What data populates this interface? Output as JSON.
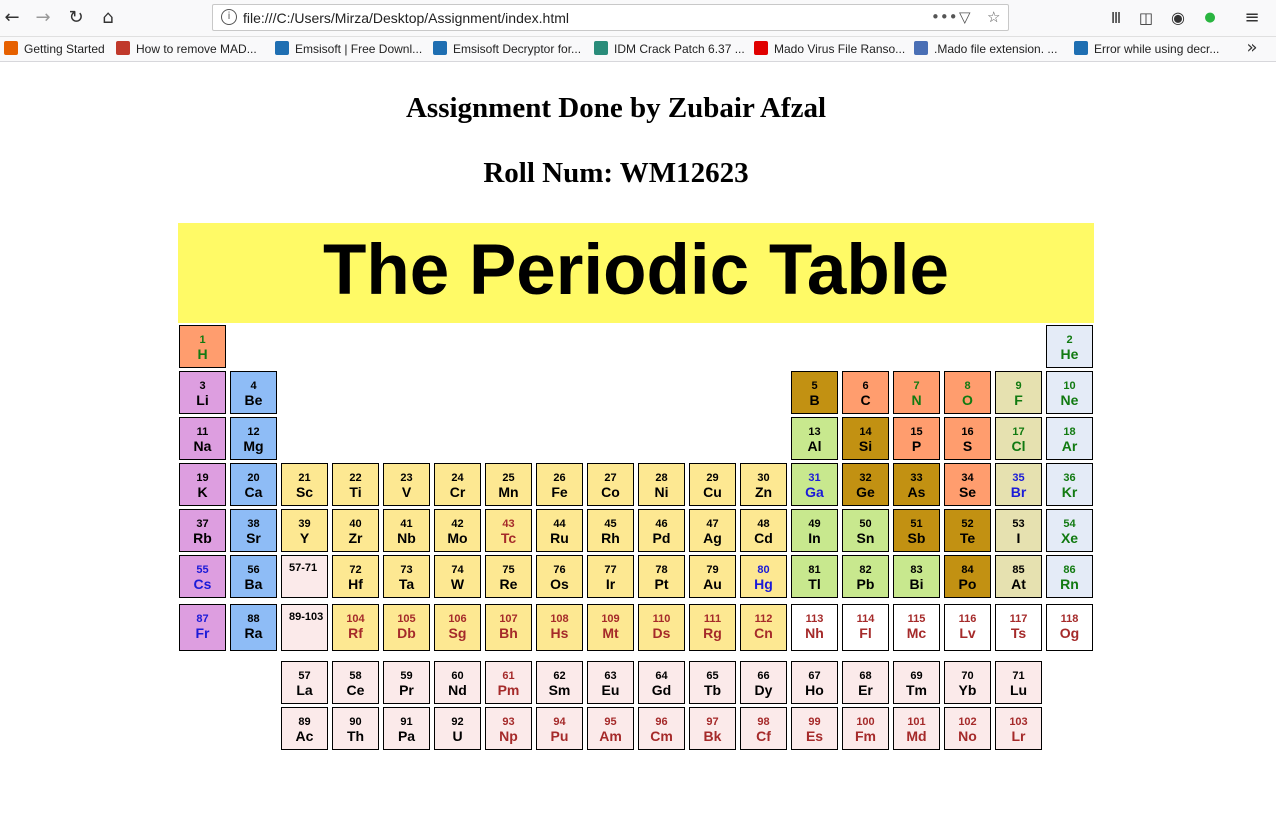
{
  "browser": {
    "url": "file:///C:/Users/Mirza/Desktop/Assignment/index.html",
    "bookmarks": [
      {
        "label": "Getting Started",
        "color": "#e66000"
      },
      {
        "label": "How to remove MAD...",
        "color": "#c0392b"
      },
      {
        "label": "Emsisoft | Free Downl...",
        "color": "#1f6fb2"
      },
      {
        "label": "Emsisoft Decryptor for...",
        "color": "#1f6fb2"
      },
      {
        "label": "IDM Crack Patch 6.37 ...",
        "color": "#2a8c7a"
      },
      {
        "label": "Mado Virus File Ranso...",
        "color": "#e00000"
      },
      {
        "label": ".Mado file extension. ...",
        "color": "#4a6fb5"
      },
      {
        "label": "Error while using decr...",
        "color": "#1f6fb2"
      }
    ],
    "icons": [
      "back-icon",
      "forward-icon",
      "reload-icon",
      "home-icon",
      "info-icon",
      "page-actions-icon",
      "pocket-icon",
      "bookmark-star-icon",
      "library-icon",
      "sidebar-icon",
      "account-icon",
      "whatsapp-icon",
      "menu-icon",
      "overflow-chevron-icon"
    ]
  },
  "page": {
    "heading": "Assignment Done by Zubair Afzal",
    "roll": "Roll Num: WM12623",
    "banner": "The Periodic Table"
  },
  "colors": {
    "banner": "#fffa66",
    "alkali": "#dd9ee0",
    "alkaline": "#8ebcf6",
    "transition": "#fde892",
    "post_transition": "#c8e88e",
    "metalloid": "#c29112",
    "nonmetal": "#ff9d6e",
    "halogen": "#e6e1b0",
    "noble": "#e4ebf7",
    "lanthanide_actinide": "#fbeaea",
    "unknown": "#ffffff",
    "gas_text": "#117a11",
    "liquid_text": "#1b1bd8",
    "synthetic_text": "#a52a2a"
  },
  "elements": [
    {
      "n": "1",
      "s": "H",
      "c": "nonmetal",
      "t": "gas"
    },
    {
      "n": "2",
      "s": "He",
      "c": "noble",
      "t": "gas"
    },
    {
      "n": "3",
      "s": "Li",
      "c": "alkali",
      "t": "solid"
    },
    {
      "n": "4",
      "s": "Be",
      "c": "alkaline",
      "t": "solid"
    },
    {
      "n": "5",
      "s": "B",
      "c": "metalloid",
      "t": "solid"
    },
    {
      "n": "6",
      "s": "C",
      "c": "nonmetal",
      "t": "solid"
    },
    {
      "n": "7",
      "s": "N",
      "c": "nonmetal",
      "t": "gas"
    },
    {
      "n": "8",
      "s": "O",
      "c": "nonmetal",
      "t": "gas"
    },
    {
      "n": "9",
      "s": "F",
      "c": "halogen",
      "t": "gas"
    },
    {
      "n": "10",
      "s": "Ne",
      "c": "noble",
      "t": "gas"
    },
    {
      "n": "11",
      "s": "Na",
      "c": "alkali",
      "t": "solid"
    },
    {
      "n": "12",
      "s": "Mg",
      "c": "alkaline",
      "t": "solid"
    },
    {
      "n": "13",
      "s": "Al",
      "c": "post",
      "t": "solid"
    },
    {
      "n": "14",
      "s": "Si",
      "c": "metalloid",
      "t": "solid"
    },
    {
      "n": "15",
      "s": "P",
      "c": "nonmetal",
      "t": "solid"
    },
    {
      "n": "16",
      "s": "S",
      "c": "nonmetal",
      "t": "solid"
    },
    {
      "n": "17",
      "s": "Cl",
      "c": "halogen",
      "t": "gas"
    },
    {
      "n": "18",
      "s": "Ar",
      "c": "noble",
      "t": "gas"
    },
    {
      "n": "19",
      "s": "K",
      "c": "alkali",
      "t": "solid"
    },
    {
      "n": "20",
      "s": "Ca",
      "c": "alkaline",
      "t": "solid"
    },
    {
      "n": "21",
      "s": "Sc",
      "c": "trans",
      "t": "solid"
    },
    {
      "n": "22",
      "s": "Ti",
      "c": "trans",
      "t": "solid"
    },
    {
      "n": "23",
      "s": "V",
      "c": "trans",
      "t": "solid"
    },
    {
      "n": "24",
      "s": "Cr",
      "c": "trans",
      "t": "solid"
    },
    {
      "n": "25",
      "s": "Mn",
      "c": "trans",
      "t": "solid"
    },
    {
      "n": "26",
      "s": "Fe",
      "c": "trans",
      "t": "solid"
    },
    {
      "n": "27",
      "s": "Co",
      "c": "trans",
      "t": "solid"
    },
    {
      "n": "28",
      "s": "Ni",
      "c": "trans",
      "t": "solid"
    },
    {
      "n": "29",
      "s": "Cu",
      "c": "trans",
      "t": "solid"
    },
    {
      "n": "30",
      "s": "Zn",
      "c": "trans",
      "t": "solid"
    },
    {
      "n": "31",
      "s": "Ga",
      "c": "post",
      "t": "liquid"
    },
    {
      "n": "32",
      "s": "Ge",
      "c": "metalloid",
      "t": "solid"
    },
    {
      "n": "33",
      "s": "As",
      "c": "metalloid",
      "t": "solid"
    },
    {
      "n": "34",
      "s": "Se",
      "c": "nonmetal",
      "t": "solid"
    },
    {
      "n": "35",
      "s": "Br",
      "c": "halogen",
      "t": "liquid"
    },
    {
      "n": "36",
      "s": "Kr",
      "c": "noble",
      "t": "gas"
    },
    {
      "n": "37",
      "s": "Rb",
      "c": "alkali",
      "t": "solid"
    },
    {
      "n": "38",
      "s": "Sr",
      "c": "alkaline",
      "t": "solid"
    },
    {
      "n": "39",
      "s": "Y",
      "c": "trans",
      "t": "solid"
    },
    {
      "n": "40",
      "s": "Zr",
      "c": "trans",
      "t": "solid"
    },
    {
      "n": "41",
      "s": "Nb",
      "c": "trans",
      "t": "solid"
    },
    {
      "n": "42",
      "s": "Mo",
      "c": "trans",
      "t": "solid"
    },
    {
      "n": "43",
      "s": "Tc",
      "c": "trans",
      "t": "synth"
    },
    {
      "n": "44",
      "s": "Ru",
      "c": "trans",
      "t": "solid"
    },
    {
      "n": "45",
      "s": "Rh",
      "c": "trans",
      "t": "solid"
    },
    {
      "n": "46",
      "s": "Pd",
      "c": "trans",
      "t": "solid"
    },
    {
      "n": "47",
      "s": "Ag",
      "c": "trans",
      "t": "solid"
    },
    {
      "n": "48",
      "s": "Cd",
      "c": "trans",
      "t": "solid"
    },
    {
      "n": "49",
      "s": "In",
      "c": "post",
      "t": "solid"
    },
    {
      "n": "50",
      "s": "Sn",
      "c": "post",
      "t": "solid"
    },
    {
      "n": "51",
      "s": "Sb",
      "c": "metalloid",
      "t": "solid"
    },
    {
      "n": "52",
      "s": "Te",
      "c": "metalloid",
      "t": "solid"
    },
    {
      "n": "53",
      "s": "I",
      "c": "halogen",
      "t": "solid"
    },
    {
      "n": "54",
      "s": "Xe",
      "c": "noble",
      "t": "gas"
    },
    {
      "n": "55",
      "s": "Cs",
      "c": "alkali",
      "t": "liquid"
    },
    {
      "n": "56",
      "s": "Ba",
      "c": "alkaline",
      "t": "solid"
    },
    {
      "n": "57-71",
      "s": "",
      "c": "lanth",
      "t": "solid",
      "ph": true
    },
    {
      "n": "72",
      "s": "Hf",
      "c": "trans",
      "t": "solid"
    },
    {
      "n": "73",
      "s": "Ta",
      "c": "trans",
      "t": "solid"
    },
    {
      "n": "74",
      "s": "W",
      "c": "trans",
      "t": "solid"
    },
    {
      "n": "75",
      "s": "Re",
      "c": "trans",
      "t": "solid"
    },
    {
      "n": "76",
      "s": "Os",
      "c": "trans",
      "t": "solid"
    },
    {
      "n": "77",
      "s": "Ir",
      "c": "trans",
      "t": "solid"
    },
    {
      "n": "78",
      "s": "Pt",
      "c": "trans",
      "t": "solid"
    },
    {
      "n": "79",
      "s": "Au",
      "c": "trans",
      "t": "solid"
    },
    {
      "n": "80",
      "s": "Hg",
      "c": "trans",
      "t": "liquid"
    },
    {
      "n": "81",
      "s": "Tl",
      "c": "post",
      "t": "solid"
    },
    {
      "n": "82",
      "s": "Pb",
      "c": "post",
      "t": "solid"
    },
    {
      "n": "83",
      "s": "Bi",
      "c": "post",
      "t": "solid"
    },
    {
      "n": "84",
      "s": "Po",
      "c": "metalloid",
      "t": "solid"
    },
    {
      "n": "85",
      "s": "At",
      "c": "halogen",
      "t": "solid"
    },
    {
      "n": "86",
      "s": "Rn",
      "c": "noble",
      "t": "gas"
    },
    {
      "n": "87",
      "s": "Fr",
      "c": "alkali",
      "t": "liquid"
    },
    {
      "n": "88",
      "s": "Ra",
      "c": "alkaline",
      "t": "solid"
    },
    {
      "n": "89-103",
      "s": "",
      "c": "lanth",
      "t": "solid",
      "ph": true
    },
    {
      "n": "104",
      "s": "Rf",
      "c": "trans",
      "t": "synth"
    },
    {
      "n": "105",
      "s": "Db",
      "c": "trans",
      "t": "synth"
    },
    {
      "n": "106",
      "s": "Sg",
      "c": "trans",
      "t": "synth"
    },
    {
      "n": "107",
      "s": "Bh",
      "c": "trans",
      "t": "synth"
    },
    {
      "n": "108",
      "s": "Hs",
      "c": "trans",
      "t": "synth"
    },
    {
      "n": "109",
      "s": "Mt",
      "c": "trans",
      "t": "synth"
    },
    {
      "n": "110",
      "s": "Ds",
      "c": "trans",
      "t": "synth"
    },
    {
      "n": "111",
      "s": "Rg",
      "c": "trans",
      "t": "synth"
    },
    {
      "n": "112",
      "s": "Cn",
      "c": "trans",
      "t": "synth"
    },
    {
      "n": "113",
      "s": "Nh",
      "c": "unknown",
      "t": "synth"
    },
    {
      "n": "114",
      "s": "Fl",
      "c": "unknown",
      "t": "synth"
    },
    {
      "n": "115",
      "s": "Mc",
      "c": "unknown",
      "t": "synth"
    },
    {
      "n": "116",
      "s": "Lv",
      "c": "unknown",
      "t": "synth"
    },
    {
      "n": "117",
      "s": "Ts",
      "c": "unknown",
      "t": "synth"
    },
    {
      "n": "118",
      "s": "Og",
      "c": "unknown",
      "t": "synth"
    },
    {
      "n": "57",
      "s": "La",
      "c": "lanth",
      "t": "solid"
    },
    {
      "n": "58",
      "s": "Ce",
      "c": "lanth",
      "t": "solid"
    },
    {
      "n": "59",
      "s": "Pr",
      "c": "lanth",
      "t": "solid"
    },
    {
      "n": "60",
      "s": "Nd",
      "c": "lanth",
      "t": "solid"
    },
    {
      "n": "61",
      "s": "Pm",
      "c": "lanth",
      "t": "synth"
    },
    {
      "n": "62",
      "s": "Sm",
      "c": "lanth",
      "t": "solid"
    },
    {
      "n": "63",
      "s": "Eu",
      "c": "lanth",
      "t": "solid"
    },
    {
      "n": "64",
      "s": "Gd",
      "c": "lanth",
      "t": "solid"
    },
    {
      "n": "65",
      "s": "Tb",
      "c": "lanth",
      "t": "solid"
    },
    {
      "n": "66",
      "s": "Dy",
      "c": "lanth",
      "t": "solid"
    },
    {
      "n": "67",
      "s": "Ho",
      "c": "lanth",
      "t": "solid"
    },
    {
      "n": "68",
      "s": "Er",
      "c": "lanth",
      "t": "solid"
    },
    {
      "n": "69",
      "s": "Tm",
      "c": "lanth",
      "t": "solid"
    },
    {
      "n": "70",
      "s": "Yb",
      "c": "lanth",
      "t": "solid"
    },
    {
      "n": "71",
      "s": "Lu",
      "c": "lanth",
      "t": "solid"
    },
    {
      "n": "89",
      "s": "Ac",
      "c": "lanth",
      "t": "solid"
    },
    {
      "n": "90",
      "s": "Th",
      "c": "lanth",
      "t": "solid"
    },
    {
      "n": "91",
      "s": "Pa",
      "c": "lanth",
      "t": "solid"
    },
    {
      "n": "92",
      "s": "U",
      "c": "lanth",
      "t": "solid"
    },
    {
      "n": "93",
      "s": "Np",
      "c": "lanth",
      "t": "synth"
    },
    {
      "n": "94",
      "s": "Pu",
      "c": "lanth",
      "t": "synth"
    },
    {
      "n": "95",
      "s": "Am",
      "c": "lanth",
      "t": "synth"
    },
    {
      "n": "96",
      "s": "Cm",
      "c": "lanth",
      "t": "synth"
    },
    {
      "n": "97",
      "s": "Bk",
      "c": "lanth",
      "t": "synth"
    },
    {
      "n": "98",
      "s": "Cf",
      "c": "lanth",
      "t": "synth"
    },
    {
      "n": "99",
      "s": "Es",
      "c": "lanth",
      "t": "synth"
    },
    {
      "n": "100",
      "s": "Fm",
      "c": "lanth",
      "t": "synth"
    },
    {
      "n": "101",
      "s": "Md",
      "c": "lanth",
      "t": "synth"
    },
    {
      "n": "102",
      "s": "No",
      "c": "lanth",
      "t": "synth"
    },
    {
      "n": "103",
      "s": "Lr",
      "c": "lanth",
      "t": "synth"
    }
  ]
}
